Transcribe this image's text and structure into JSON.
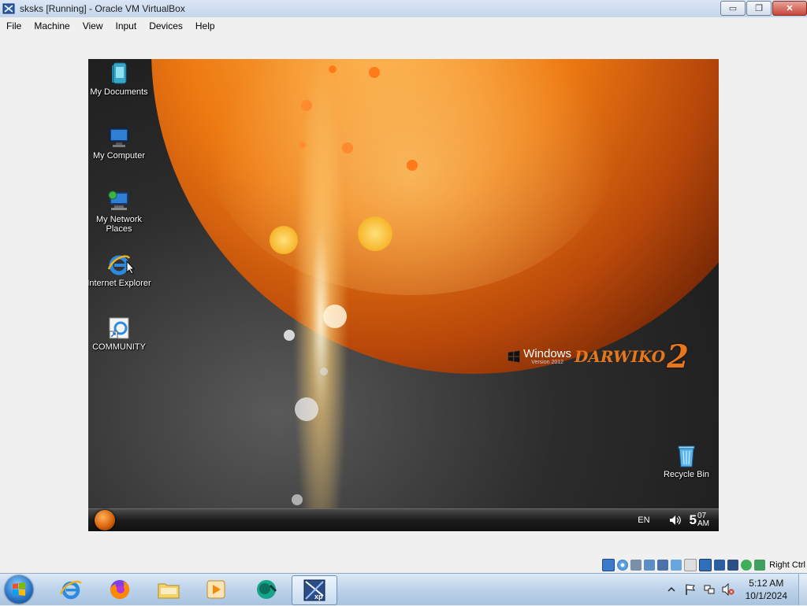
{
  "window": {
    "title": "sksks [Running] - Oracle VM VirtualBox",
    "buttons": {
      "minimize": "▭",
      "restore": "❐",
      "close": "✕"
    }
  },
  "menubar": {
    "items": [
      "File",
      "Machine",
      "View",
      "Input",
      "Devices",
      "Help"
    ]
  },
  "guest": {
    "desktop_icons": [
      {
        "label": "My Documents",
        "icon": "my-documents-icon"
      },
      {
        "label": "My Computer",
        "icon": "my-computer-icon"
      },
      {
        "label": "My Network Places",
        "icon": "my-network-places-icon"
      },
      {
        "label": "Internet Explorer",
        "icon": "internet-explorer-icon"
      },
      {
        "label": "COMMUNITY",
        "icon": "community-shortcut-icon"
      },
      {
        "label": "Recycle Bin",
        "icon": "recycle-bin-icon"
      }
    ],
    "brand": {
      "windows": "Windows",
      "version": "Version 2012",
      "edition": "DARWIKO",
      "number": "2"
    },
    "taskbar": {
      "language": "EN",
      "clock_hour": "5",
      "clock_minutes": "07",
      "clock_ampm": "AM"
    },
    "colors": {
      "accent": "#e8761a",
      "taskbar": "#1c1c1c"
    }
  },
  "vbox_status": {
    "host_key": "Right Ctrl"
  },
  "host_taskbar": {
    "pinned": [
      "internet-explorer",
      "firefox",
      "file-explorer",
      "media-player",
      "virtualbox-app",
      "windows-xp-vm"
    ],
    "clock_time": "5:12 AM",
    "clock_date": "10/1/2024"
  }
}
